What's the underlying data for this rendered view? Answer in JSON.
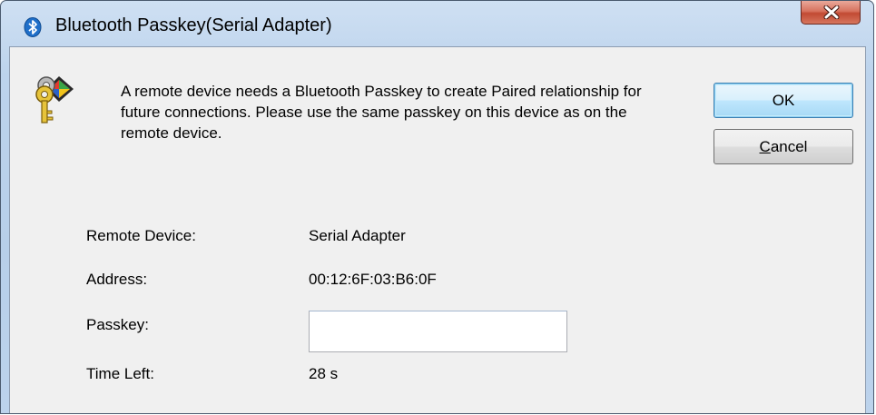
{
  "window": {
    "title": "Bluetooth Passkey(Serial Adapter)",
    "close_label": "Close"
  },
  "message": "A remote device needs a Bluetooth Passkey to create Paired relationship for future connections. Please use the same passkey on this device as on the remote device.",
  "buttons": {
    "ok_label": "OK",
    "cancel_mnemonic": "C",
    "cancel_rest": "ancel"
  },
  "fields": {
    "remote_device_label": "Remote Device:",
    "remote_device_value": "Serial Adapter",
    "address_label": "Address:",
    "address_value": "00:12:6F:03:B6:0F",
    "passkey_label": "Passkey:",
    "passkey_value": "",
    "time_left_label": "Time Left:",
    "time_left_value": "28 s"
  },
  "icons": {
    "title_icon": "bluetooth-icon",
    "message_icon": "keys-icon",
    "close_icon": "close-icon"
  },
  "colors": {
    "bluetooth_blue": "#1f6fc9",
    "close_red": "#c9503a",
    "key_gold": "#d9b52a"
  }
}
